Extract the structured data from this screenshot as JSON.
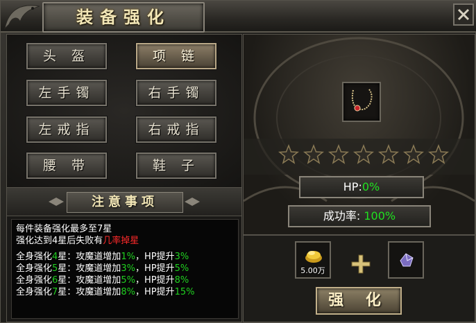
{
  "window": {
    "title": "装备强化",
    "colors": {
      "gold_text": "#f2e6b6",
      "value_green": "#20d020",
      "warning_red": "#ff2a2a"
    }
  },
  "slots": {
    "helmet": "头 盔",
    "necklace": "项 链",
    "left_bracelet": "左手镯",
    "right_bracelet": "右手镯",
    "left_ring": "左戒指",
    "right_ring": "右戒指",
    "belt": "腰 带",
    "shoes": "鞋 子",
    "selected": "necklace"
  },
  "notice": {
    "title": "注意事项",
    "line1": "每件装备强化最多至7星",
    "line2_prefix": "强化达到4星后失败有",
    "line2_warning": "几率掉星",
    "bonus_rows": [
      {
        "prefix": "全身强化",
        "stars": "4",
        "mid": "星：攻魔道增加",
        "atk": "1%",
        "hp_label": "，HP提升",
        "hp": "3%"
      },
      {
        "prefix": "全身强化",
        "stars": "5",
        "mid": "星：攻魔道增加",
        "atk": "3%",
        "hp_label": "，HP提升",
        "hp": "5%"
      },
      {
        "prefix": "全身强化",
        "stars": "6",
        "mid": "星：攻魔道增加",
        "atk": "5%",
        "hp_label": "，HP提升",
        "hp": "8%"
      },
      {
        "prefix": "全身强化",
        "stars": "7",
        "mid": "星：攻魔道增加",
        "atk": "8%",
        "hp_label": "，HP提升",
        "hp": "15%"
      }
    ]
  },
  "item": {
    "icon": "necklace-icon",
    "stars_total": 7,
    "stars_filled": 0
  },
  "stats": {
    "hp_label": "HP:",
    "hp_value": "0%",
    "success_label": "成功率: ",
    "success_value": "100%"
  },
  "cost": {
    "gold_amount": "5.00万",
    "gold_icon": "gold-coins-icon",
    "material_icon": "purple-gem-icon",
    "plus_icon": "plus-icon"
  },
  "actions": {
    "enhance_label": "强 化"
  }
}
